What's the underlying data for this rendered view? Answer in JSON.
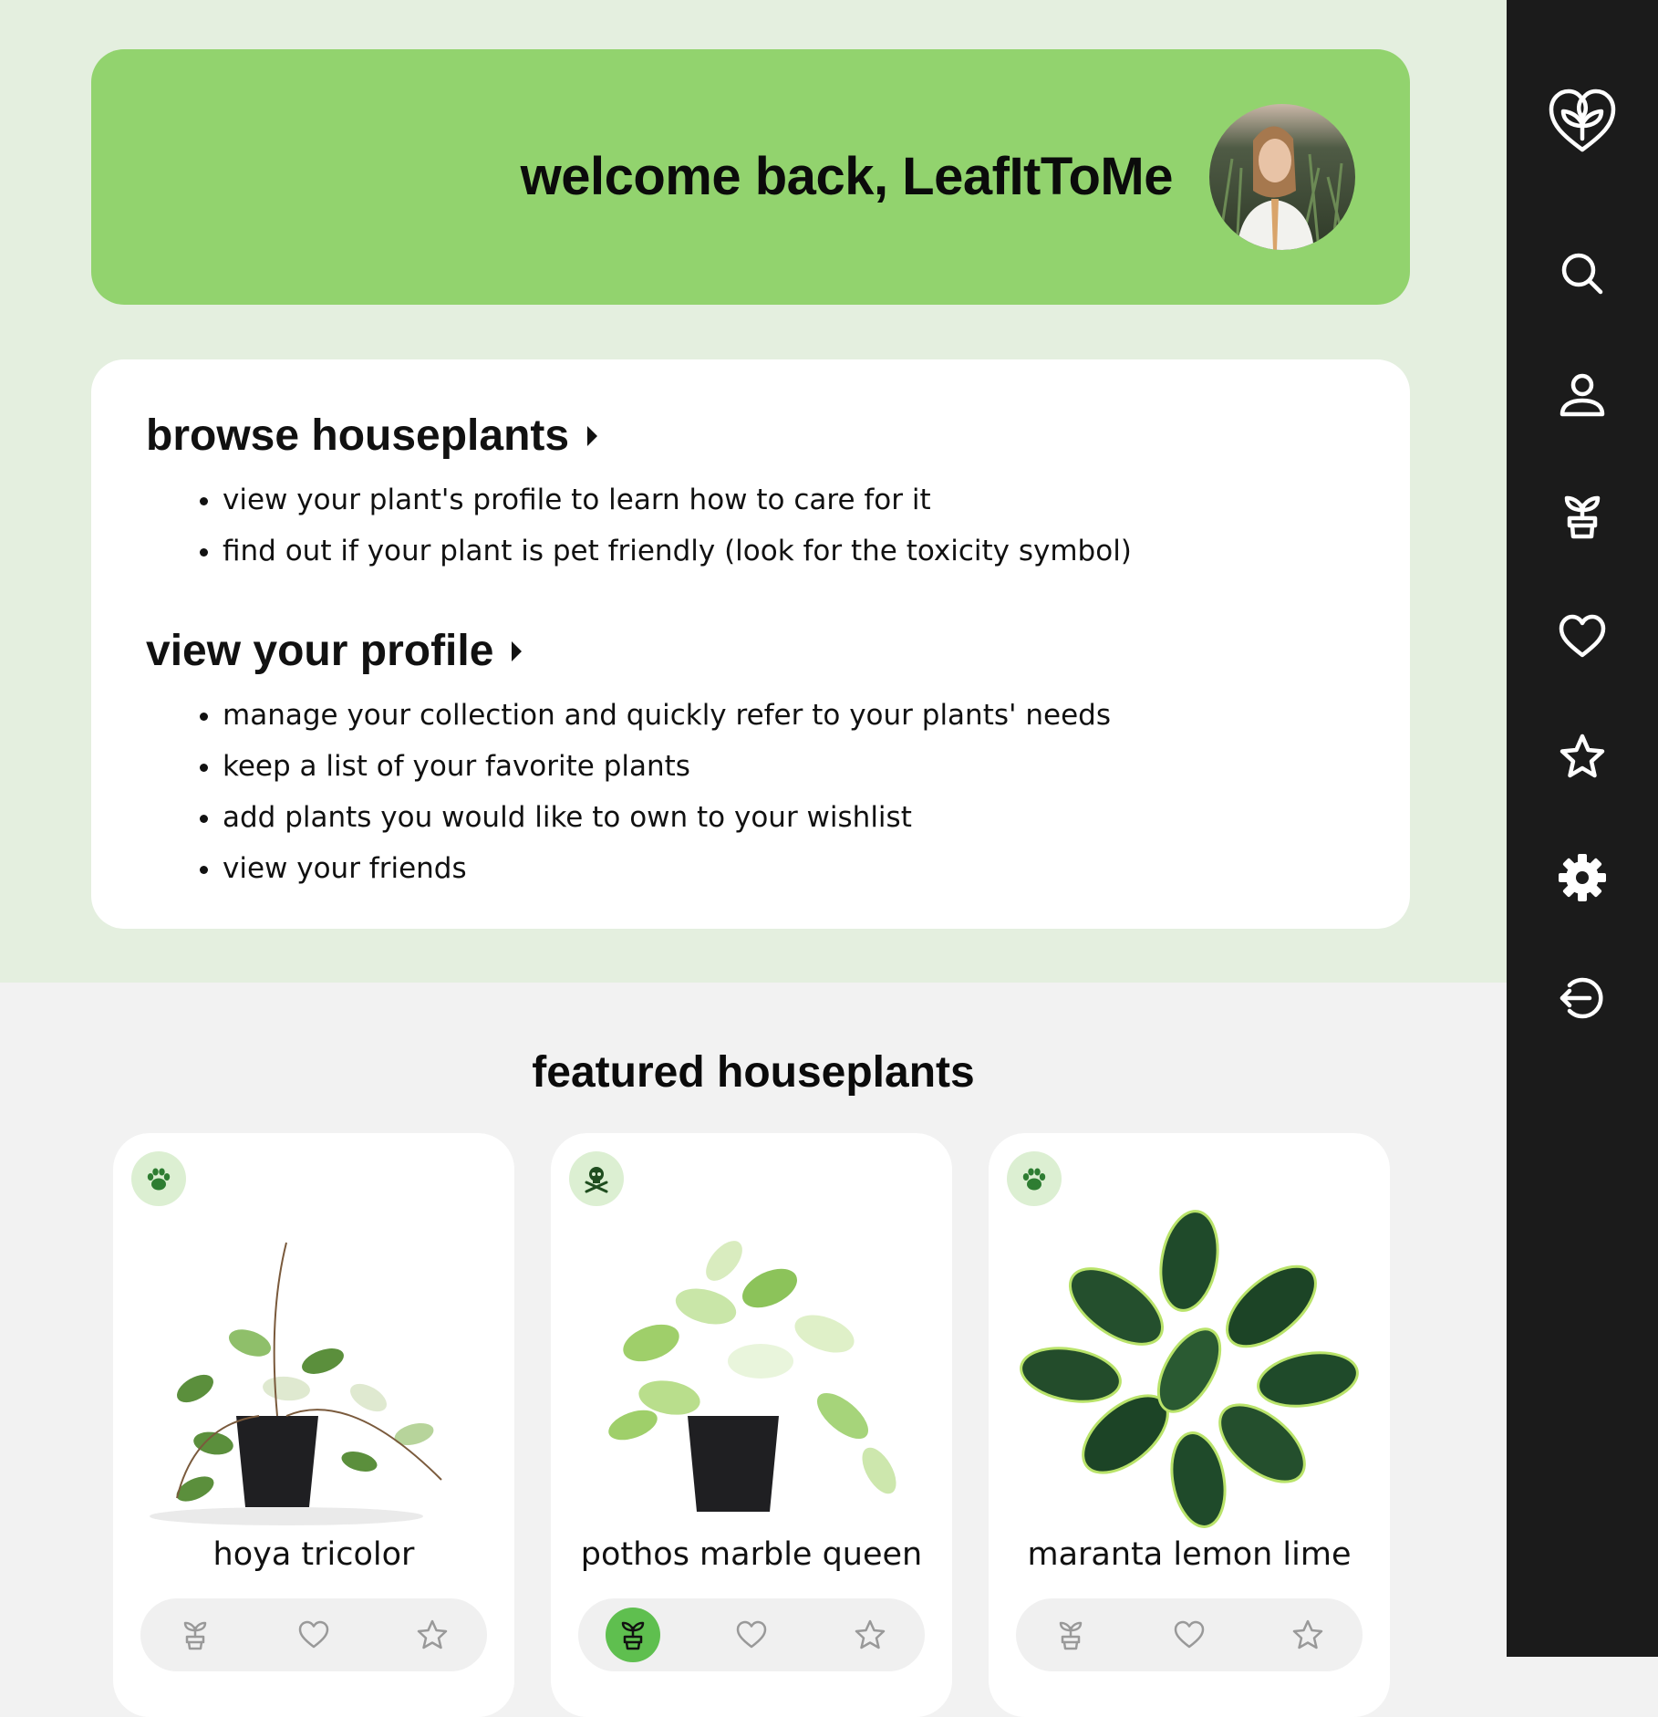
{
  "welcome": {
    "greeting": "welcome back, LeafItToMe"
  },
  "info": {
    "browse": {
      "title": "browse houseplants",
      "bullets": [
        "view your plant's profile to learn how to care for it",
        "find out if your plant is pet friendly (look for the toxicity symbol)"
      ]
    },
    "profile": {
      "title": "view your profile",
      "bullets": [
        "manage your collection and quickly refer to your plants' needs",
        "keep a list of your favorite plants",
        "add plants you would like to own to your wishlist",
        "view your friends"
      ]
    }
  },
  "featured": {
    "title": "featured houseplants",
    "plants": [
      {
        "name": "hoya tricolor",
        "badge": "paw-icon",
        "owned": false
      },
      {
        "name": "pothos marble queen",
        "badge": "skull-crossbones-icon",
        "owned": true
      },
      {
        "name": "maranta lemon lime",
        "badge": "paw-icon",
        "owned": false
      }
    ]
  },
  "sidebar": {
    "items": [
      "logo-icon",
      "search-icon",
      "profile-icon",
      "plant-pot-icon",
      "heart-icon",
      "star-icon",
      "gear-icon",
      "logout-icon"
    ]
  },
  "colors": {
    "banner": "#92d36e",
    "top_background": "#e4efdf",
    "sidebar": "#1b1b1b",
    "accent": "#5fbf4f",
    "badge": "#dcefd2"
  }
}
